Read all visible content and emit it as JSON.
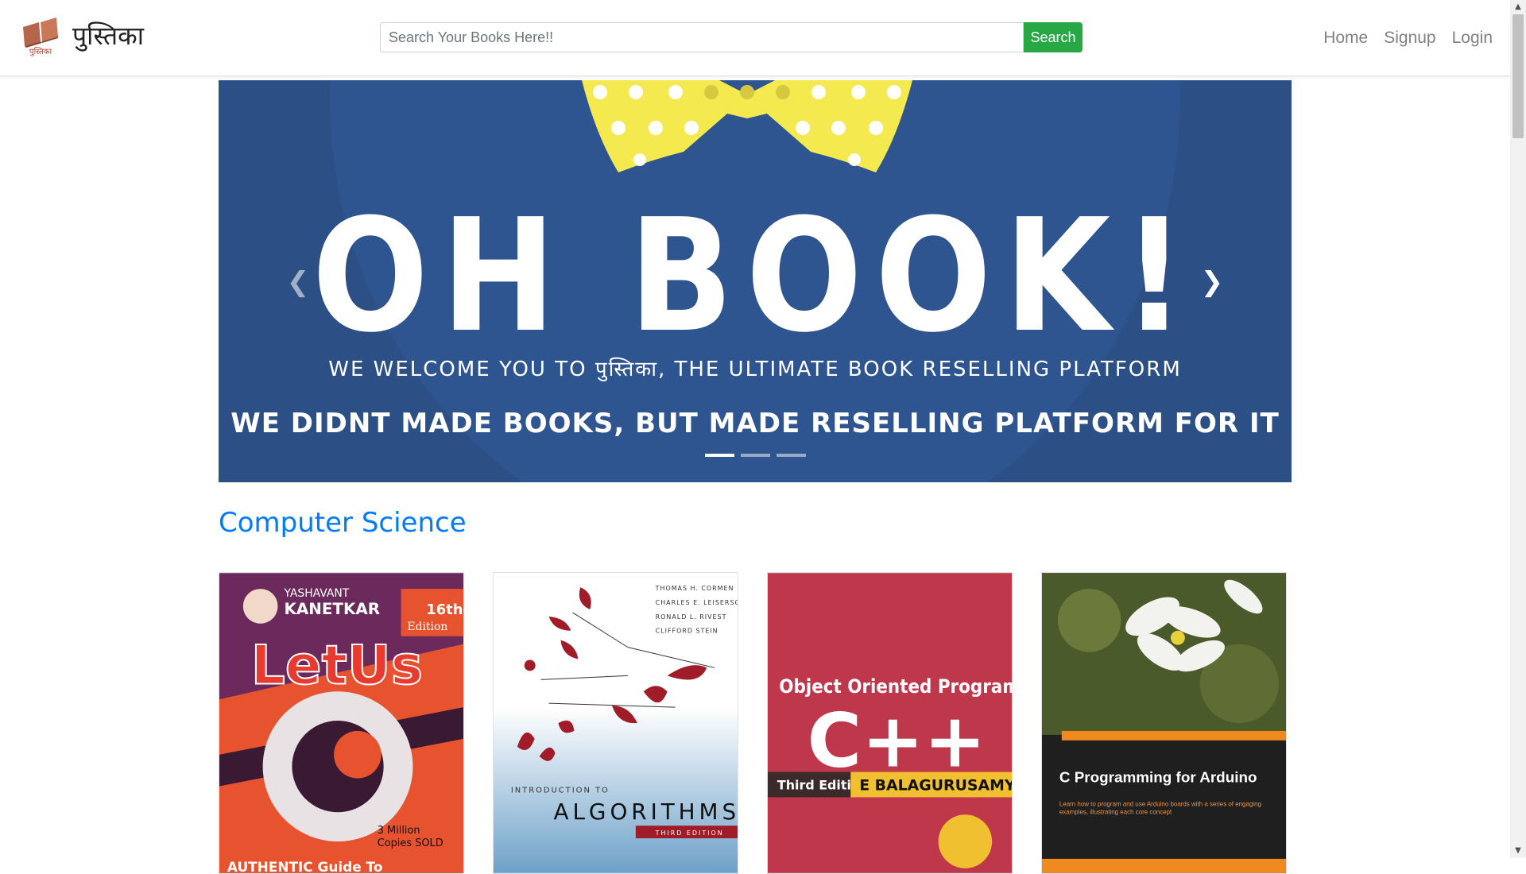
{
  "brand": {
    "name": "पुस्तिका",
    "logo_icon": "open-book-icon"
  },
  "search": {
    "placeholder": "Search Your Books Here!!",
    "value": "",
    "button_label": "Search"
  },
  "nav": {
    "items": [
      {
        "label": "Home"
      },
      {
        "label": "Signup"
      },
      {
        "label": "Login"
      }
    ]
  },
  "carousel": {
    "title": "OH BOOK!",
    "subtitle": "WE WELCOME YOU TO पुस्तिका, THE ULTIMATE BOOK RESELLING PLATFORM",
    "tagline": "WE DIDNT MADE BOOKS, BUT MADE RESELLING PLATFORM FOR IT",
    "prev_icon": "chevron-left-icon",
    "next_icon": "chevron-right-icon",
    "slides": 3,
    "active_slide": 1
  },
  "section": {
    "title": "Computer Science"
  },
  "books": [
    {
      "cover_lines": [
        "YASHAVANT",
        "KANETKAR",
        "16th",
        "Edition",
        "LetUs",
        "C",
        "3 Million",
        "Copies SOLD",
        "AUTHENTIC Guide To"
      ]
    },
    {
      "cover_lines": [
        "THOMAS H. CORMEN",
        "CHARLES E. LEISERSON",
        "RONALD L. RIVEST",
        "CLIFFORD STEIN",
        "INTRODUCTION TO",
        "ALGORITHMS",
        "THIRD EDITION"
      ]
    },
    {
      "cover_lines": [
        "Object Oriented Programming",
        "C++",
        "Third Edition",
        "E BALAGURUSAMY"
      ]
    },
    {
      "cover_lines": [
        "C Programming for Arduino",
        "Learn how to program and use Arduino boards with a series of engaging examples, illustrating each core concept"
      ]
    }
  ],
  "colors": {
    "accent": "#007bff",
    "search_button": "#28a745",
    "carousel_bg": "#2c5085"
  }
}
